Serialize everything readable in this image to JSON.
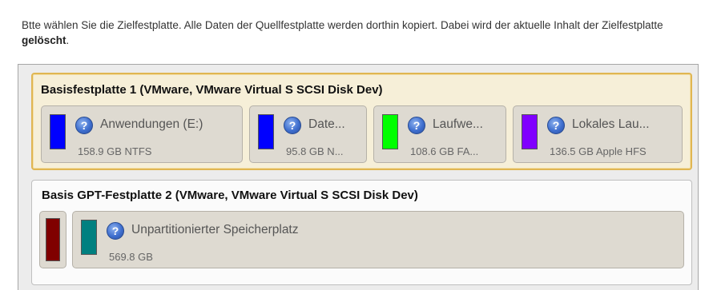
{
  "instructions": {
    "text_before": "Btte wählen Sie die Zielfestplatte. Alle Daten der Quellfestplatte werden dorthin kopiert. Dabei wird der aktuelle Inhalt der Zielfestplatte ",
    "bold_word": "gelöscht",
    "text_after": "."
  },
  "disks": [
    {
      "title": "Basisfestplatte 1 (VMware, VMware Virtual S SCSI Disk Dev)",
      "partitions": [
        {
          "name": "Anwendungen (E:)",
          "info": "158.9 GB NTFS",
          "color": "#0000ff",
          "icon": "help-icon"
        },
        {
          "name": "Date...",
          "info": "95.8 GB N...",
          "color": "#0000ff",
          "icon": "help-icon"
        },
        {
          "name": "Laufwe...",
          "info": "108.6 GB FA...",
          "color": "#00ff00",
          "icon": "help-icon"
        },
        {
          "name": "Lokales Lau...",
          "info": "136.5 GB Apple HFS",
          "color": "#8000ff",
          "icon": "help-icon"
        }
      ]
    },
    {
      "title": "Basis GPT-Festplatte 2 (VMware, VMware Virtual S SCSI Disk Dev)",
      "small_block": {
        "color": "#800000"
      },
      "partitions": [
        {
          "name": "Unpartitionierter Speicherplatz",
          "info": "569.8 GB",
          "color": "#008080",
          "icon": "help-icon"
        }
      ]
    }
  ],
  "colors": {
    "selected_border": "#e0b652",
    "selected_background": "#f6efd8",
    "partition_background": "#dedad1"
  }
}
